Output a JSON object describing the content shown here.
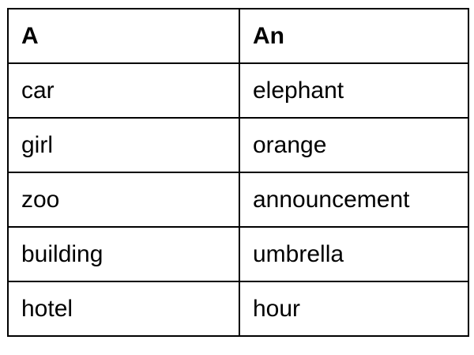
{
  "table": {
    "headers": [
      "A",
      "An"
    ],
    "rows": [
      [
        "car",
        "elephant"
      ],
      [
        "girl",
        "orange"
      ],
      [
        "zoo",
        "announcement"
      ],
      [
        "building",
        "umbrella"
      ],
      [
        "hotel",
        "hour"
      ]
    ]
  }
}
